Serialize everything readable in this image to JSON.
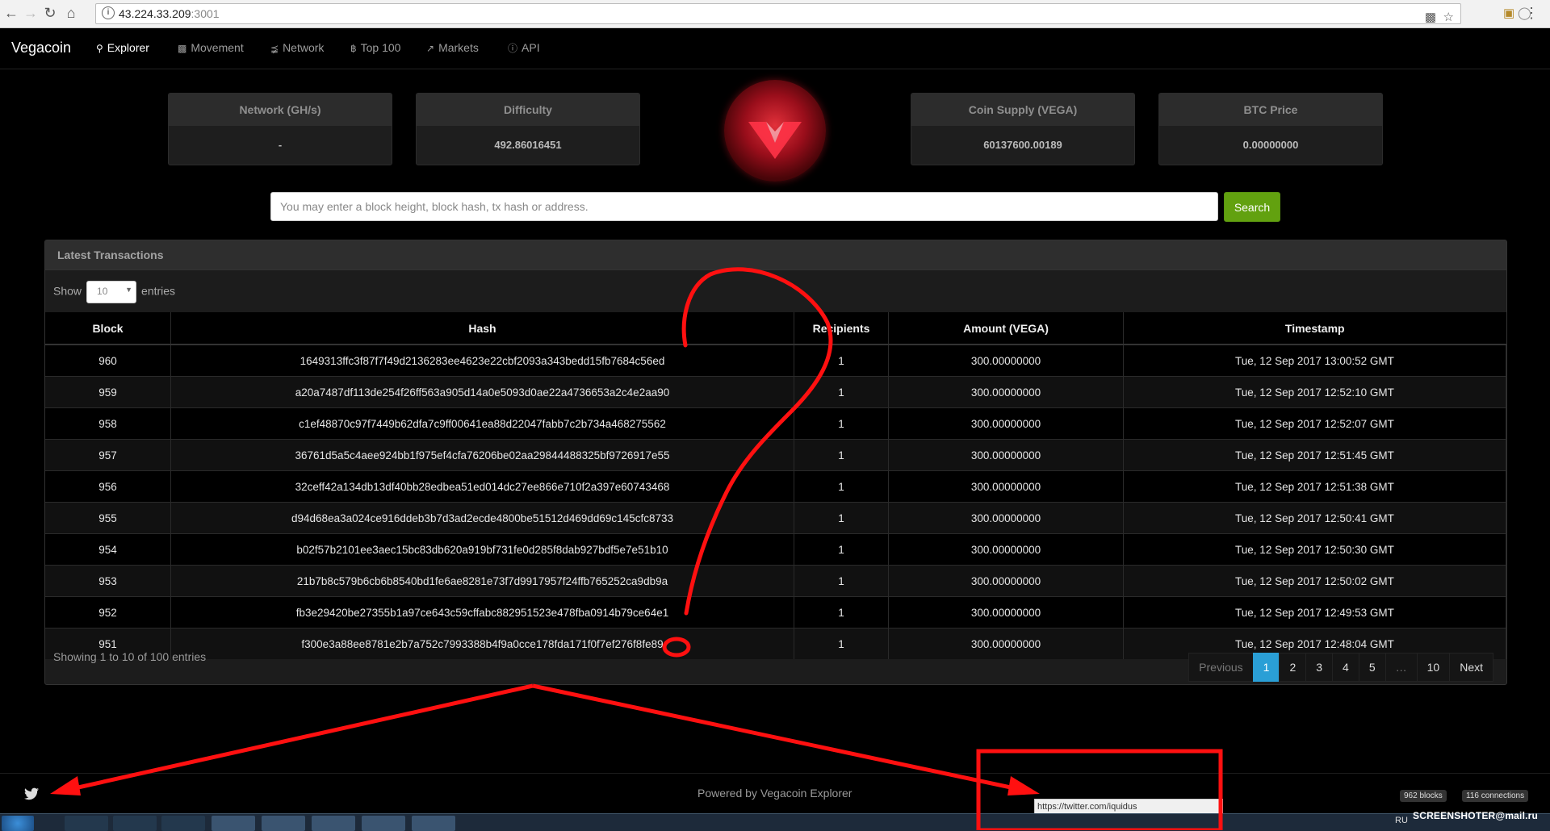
{
  "browser": {
    "url_host": "43.224.33.209",
    "url_port": ":3001"
  },
  "nav": {
    "brand": "Vegacoin",
    "items": [
      {
        "label": "Explorer",
        "icon": "search-icon",
        "active": true
      },
      {
        "label": "Movement",
        "icon": "money-icon"
      },
      {
        "label": "Network",
        "icon": "share-icon"
      },
      {
        "label": "Top 100",
        "icon": "bitcoin-icon"
      },
      {
        "label": "Markets",
        "icon": "chart-icon"
      },
      {
        "label": "API",
        "icon": "info-icon"
      }
    ]
  },
  "stats": {
    "network": {
      "label": "Network (GH/s)",
      "value": "-"
    },
    "difficulty": {
      "label": "Difficulty",
      "value": "492.86016451"
    },
    "supply": {
      "label": "Coin Supply (VEGA)",
      "value": "60137600.00189"
    },
    "btc_price": {
      "label": "BTC Price",
      "value": "0.00000000"
    }
  },
  "search": {
    "placeholder": "You may enter a block height, block hash, tx hash or address.",
    "button": "Search"
  },
  "transactions": {
    "title": "Latest Transactions",
    "show_label": "Show",
    "entries_label": "entries",
    "page_length": "10",
    "columns": [
      "Block",
      "Hash",
      "Recipients",
      "Amount (VEGA)",
      "Timestamp"
    ],
    "rows": [
      [
        "960",
        "1649313ffc3f87f7f49d2136283ee4623e22cbf2093a343bedd15fb7684c56ed",
        "1",
        "300.00000000",
        "Tue, 12 Sep 2017 13:00:52 GMT"
      ],
      [
        "959",
        "a20a7487df113de254f26ff563a905d14a0e5093d0ae22a4736653a2c4e2aa90",
        "1",
        "300.00000000",
        "Tue, 12 Sep 2017 12:52:10 GMT"
      ],
      [
        "958",
        "c1ef48870c97f7449b62dfa7c9ff00641ea88d22047fabb7c2b734a468275562",
        "1",
        "300.00000000",
        "Tue, 12 Sep 2017 12:52:07 GMT"
      ],
      [
        "957",
        "36761d5a5c4aee924bb1f975ef4cfa76206be02aa29844488325bf9726917e55",
        "1",
        "300.00000000",
        "Tue, 12 Sep 2017 12:51:45 GMT"
      ],
      [
        "956",
        "32ceff42a134db13df40bb28edbea51ed014dc27ee866e710f2a397e60743468",
        "1",
        "300.00000000",
        "Tue, 12 Sep 2017 12:51:38 GMT"
      ],
      [
        "955",
        "d94d68ea3a024ce916ddeb3b7d3ad2ecde4800be51512d469dd69c145cfc8733",
        "1",
        "300.00000000",
        "Tue, 12 Sep 2017 12:50:41 GMT"
      ],
      [
        "954",
        "b02f57b2101ee3aec15bc83db620a919bf731fe0d285f8dab927bdf5e7e51b10",
        "1",
        "300.00000000",
        "Tue, 12 Sep 2017 12:50:30 GMT"
      ],
      [
        "953",
        "21b7b8c579b6cb6b8540bd1fe6ae8281e73f7d9917957f24ffb765252ca9db9a",
        "1",
        "300.00000000",
        "Tue, 12 Sep 2017 12:50:02 GMT"
      ],
      [
        "952",
        "fb3e29420be27355b1a97ce643c59cffabc882951523e478fba0914b79ce64e1",
        "1",
        "300.00000000",
        "Tue, 12 Sep 2017 12:49:53 GMT"
      ],
      [
        "951",
        "f300e3a88ee8781e2b7a752c7993388b4f9a0cce178fda171f0f7ef276f8fe89",
        "1",
        "300.00000000",
        "Tue, 12 Sep 2017 12:48:04 GMT"
      ]
    ],
    "info": "Showing 1 to 10 of 100 entries",
    "pagination": {
      "previous": "Previous",
      "pages": [
        "1",
        "2",
        "3",
        "4",
        "5",
        "…",
        "10"
      ],
      "active_page": "1",
      "next": "Next"
    }
  },
  "footer": {
    "powered_by": "Powered by Vegacoin Explorer",
    "blocks_badge": "962 blocks",
    "connections_badge": "116 connections",
    "status_url": "https://twitter.com/iquidus"
  },
  "taskbar": {
    "lang": "RU",
    "watermark": "SCREENSHOTER@mail.ru"
  },
  "colors": {
    "search_button": "#62a10f",
    "active_page": "#2a9fd6",
    "annotation": "#ff1010"
  }
}
